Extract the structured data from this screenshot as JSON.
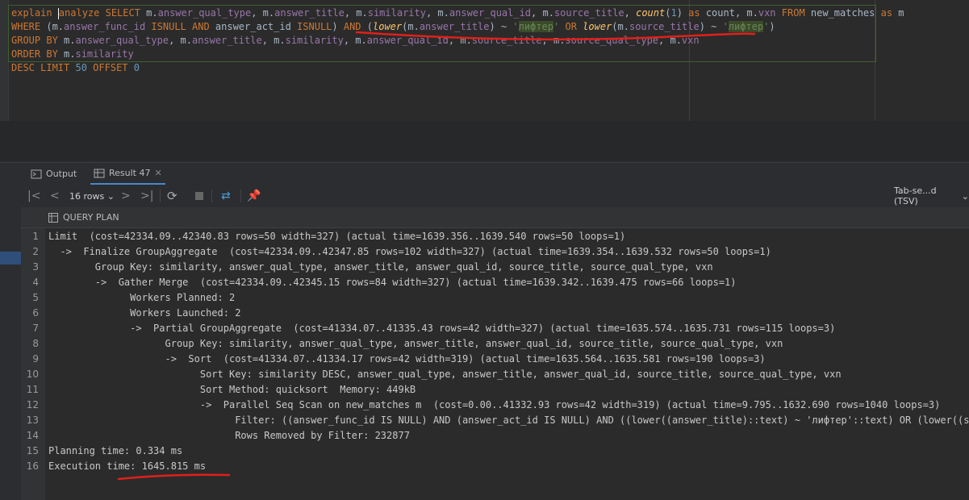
{
  "editor": {
    "sql_lines": [
      "explain analyze SELECT m.answer_qual_type, m.answer_title, m.similarity, m.answer_qual_id, m.source_title, count(1) as count, m.vxn FROM new_matches as m",
      "WHERE (m.answer_func_id ISNULL AND answer_act_id ISNULL) AND (lower(m.answer_title) ~ 'лифтер' OR lower(m.source_title) ~ 'лифтер')",
      "GROUP BY m.answer_qual_type, m.answer_title, m.similarity, m.answer_qual_id, m.source_title, m.source_qual_type, m.vxn",
      "ORDER BY m.similarity",
      "DESC LIMIT 50 OFFSET 0"
    ]
  },
  "tabs": [
    {
      "label": "Output",
      "icon": "console-icon"
    },
    {
      "label": "Result 47",
      "icon": "table-icon"
    }
  ],
  "toolbar": {
    "rows_label": "16 rows",
    "export_format": "Tab-se...d (TSV)"
  },
  "results": {
    "column_header": "QUERY PLAN",
    "rows": [
      {
        "num": "1",
        "text": "Limit  (cost=42334.09..42340.83 rows=50 width=327) (actual time=1639.356..1639.540 rows=50 loops=1)"
      },
      {
        "num": "2",
        "text": "  ->  Finalize GroupAggregate  (cost=42334.09..42347.85 rows=102 width=327) (actual time=1639.354..1639.532 rows=50 loops=1)"
      },
      {
        "num": "3",
        "text": "        Group Key: similarity, answer_qual_type, answer_title, answer_qual_id, source_title, source_qual_type, vxn"
      },
      {
        "num": "4",
        "text": "        ->  Gather Merge  (cost=42334.09..42345.15 rows=84 width=327) (actual time=1639.342..1639.475 rows=66 loops=1)"
      },
      {
        "num": "5",
        "text": "              Workers Planned: 2"
      },
      {
        "num": "6",
        "text": "              Workers Launched: 2"
      },
      {
        "num": "7",
        "text": "              ->  Partial GroupAggregate  (cost=41334.07..41335.43 rows=42 width=327) (actual time=1635.574..1635.731 rows=115 loops=3)"
      },
      {
        "num": "8",
        "text": "                    Group Key: similarity, answer_qual_type, answer_title, answer_qual_id, source_title, source_qual_type, vxn"
      },
      {
        "num": "9",
        "text": "                    ->  Sort  (cost=41334.07..41334.17 rows=42 width=319) (actual time=1635.564..1635.581 rows=190 loops=3)"
      },
      {
        "num": "10",
        "text": "                          Sort Key: similarity DESC, answer_qual_type, answer_title, answer_qual_id, source_title, source_qual_type, vxn"
      },
      {
        "num": "11",
        "text": "                          Sort Method: quicksort  Memory: 449kB"
      },
      {
        "num": "12",
        "text": "                          ->  Parallel Seq Scan on new_matches m  (cost=0.00..41332.93 rows=42 width=319) (actual time=9.795..1632.690 rows=1040 loops=3)"
      },
      {
        "num": "13",
        "text": "                                Filter: ((answer_func_id IS NULL) AND (answer_act_id IS NULL) AND ((lower((answer_title)::text) ~ 'лифтер'::text) OR (lower((source"
      },
      {
        "num": "14",
        "text": "                                Rows Removed by Filter: 232877"
      },
      {
        "num": "15",
        "text": "Planning time: 0.334 ms"
      },
      {
        "num": "16",
        "text": "Execution time: 1645.815 ms"
      }
    ]
  }
}
